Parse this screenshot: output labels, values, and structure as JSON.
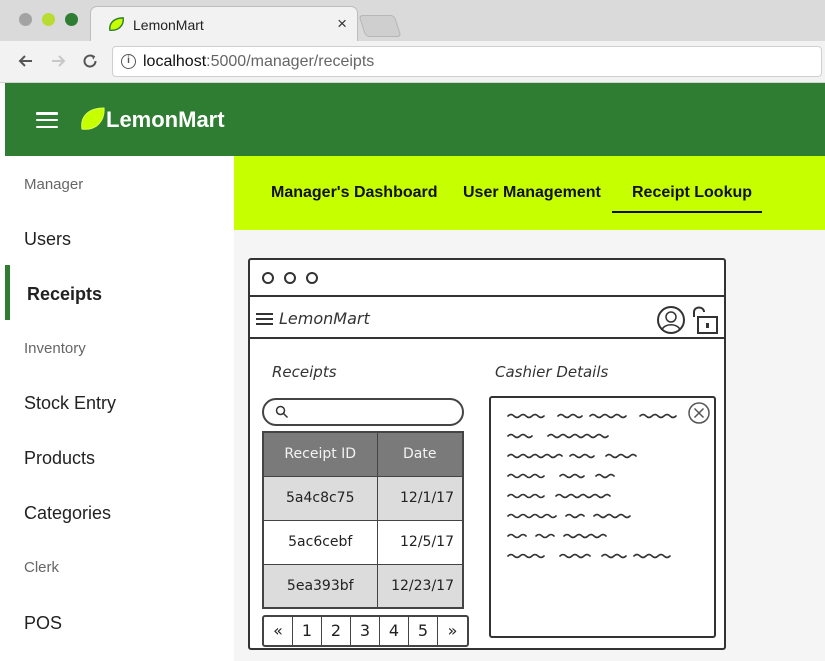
{
  "browser": {
    "tab_title": "LemonMart",
    "tab_close": "×",
    "url_host": "localhost",
    "url_path": ":5000/manager/receipts"
  },
  "app": {
    "title": "LemonMart",
    "colors": {
      "primary": "#2e7d32",
      "accent": "#c6ff00"
    }
  },
  "sidebar": {
    "sections": [
      {
        "heading": "Manager",
        "items": [
          "Users",
          "Receipts"
        ]
      },
      {
        "heading": "Inventory",
        "items": [
          "Stock Entry",
          "Products",
          "Categories"
        ]
      },
      {
        "heading": "Clerk",
        "items": [
          "POS"
        ]
      }
    ],
    "active_item": "Receipts"
  },
  "tabs": [
    {
      "label": "Manager's Dashboard"
    },
    {
      "label": "User Management"
    },
    {
      "label": "Receipt Lookup",
      "active": true
    }
  ],
  "wireframe": {
    "brand": "LemonMart",
    "receipts_label": "Receipts",
    "cashier_label": "Cashier Details",
    "table": {
      "headers": [
        "Receipt ID",
        "Date"
      ],
      "rows": [
        {
          "id": "5a4c8c75",
          "date": "12/1/17"
        },
        {
          "id": "5ac6cebf",
          "date": "12/5/17"
        },
        {
          "id": "5ea393bf",
          "date": "12/23/17"
        }
      ]
    },
    "pager": [
      "«",
      "1",
      "2",
      "3",
      "4",
      "5",
      "»"
    ]
  }
}
